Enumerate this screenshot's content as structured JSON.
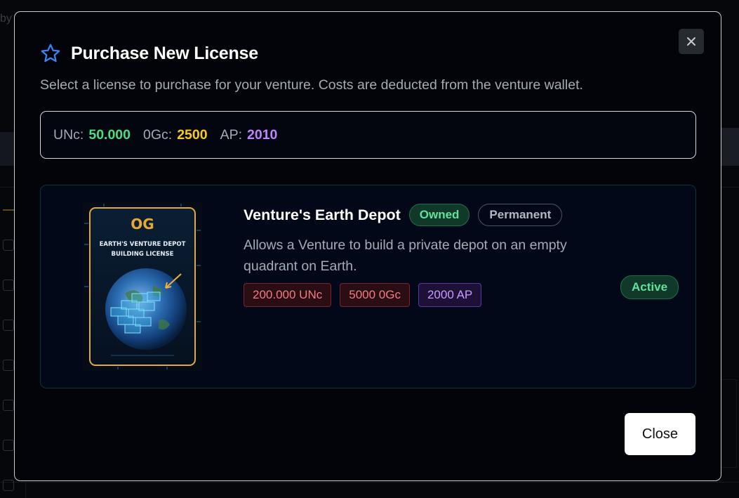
{
  "background": {
    "top_text": "by"
  },
  "modal": {
    "title": "Purchase New License",
    "subtitle": "Select a license to purchase for your venture. Costs are deducted from the venture wallet.",
    "close_icon": "close-icon",
    "title_icon": "star-icon"
  },
  "wallet": {
    "unc_label": "UNc:",
    "unc_value": "50.000",
    "ogc_label": "0Gc:",
    "ogc_value": "2500",
    "ap_label": "AP:",
    "ap_value": "2010"
  },
  "license": {
    "title": "Venture's Earth Depot",
    "owned_badge": "Owned",
    "permanent_badge": "Permanent",
    "description": "Allows a Venture to build a private depot on an empty quadrant on Earth.",
    "costs": [
      "200.000 UNc",
      "5000 0Gc",
      "2000 AP"
    ],
    "status": "Active",
    "image": {
      "logo": "OG",
      "caption_line1": "EARTH'S VENTURE DEPOT",
      "caption_line2": "BUILDING LICENSE"
    }
  },
  "footer": {
    "close_label": "Close"
  },
  "colors": {
    "accent_blue": "#3b82f6",
    "unc_green": "#4ade80",
    "ogc_yellow": "#facc15",
    "ap_purple": "#c084fc"
  }
}
